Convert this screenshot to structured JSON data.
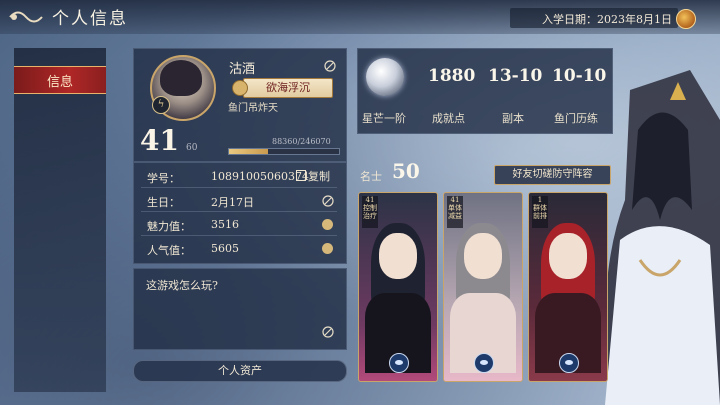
{
  "header": {
    "title": "个人信息",
    "enroll_label": "入学日期：2023年8月1日"
  },
  "sidebar": {
    "items": [
      {
        "label": "信息"
      }
    ]
  },
  "profile": {
    "name": "沽酒",
    "title_tag": "欲海浮沉",
    "guild": "鱼门吊炸天",
    "level": "41",
    "level_cap": "60",
    "exp_text": "88360/246070",
    "exp_fraction": 0.359
  },
  "info_rows": [
    {
      "label": "学号：",
      "value": "10891005060374"
    },
    {
      "label": "生日：",
      "value": "2月17日"
    },
    {
      "label": "魅力值：",
      "value": "3516"
    },
    {
      "label": "人气值：",
      "value": "5605"
    }
  ],
  "copy_label": "复制",
  "signature": "这游戏怎么玩?",
  "assets_button": "个人资产",
  "stats": [
    {
      "value": "1880",
      "label": "成就点"
    },
    {
      "value": "13-10",
      "label": "副本"
    },
    {
      "value": "10-10",
      "label": "鱼门历练"
    }
  ],
  "rank_label": "星芒一阶",
  "fame": {
    "label": "名士",
    "value": "50"
  },
  "switch_button": "好友切磋防守阵容",
  "cards": [
    {
      "level": "41",
      "tags": "控制 治疗"
    },
    {
      "level": "41",
      "tags": "单体 减益"
    },
    {
      "level": "1",
      "tags": "群体 前排"
    }
  ],
  "colors": {
    "accent_red": "#b02727",
    "gold": "#c9a56a",
    "panel": "#22304a"
  }
}
